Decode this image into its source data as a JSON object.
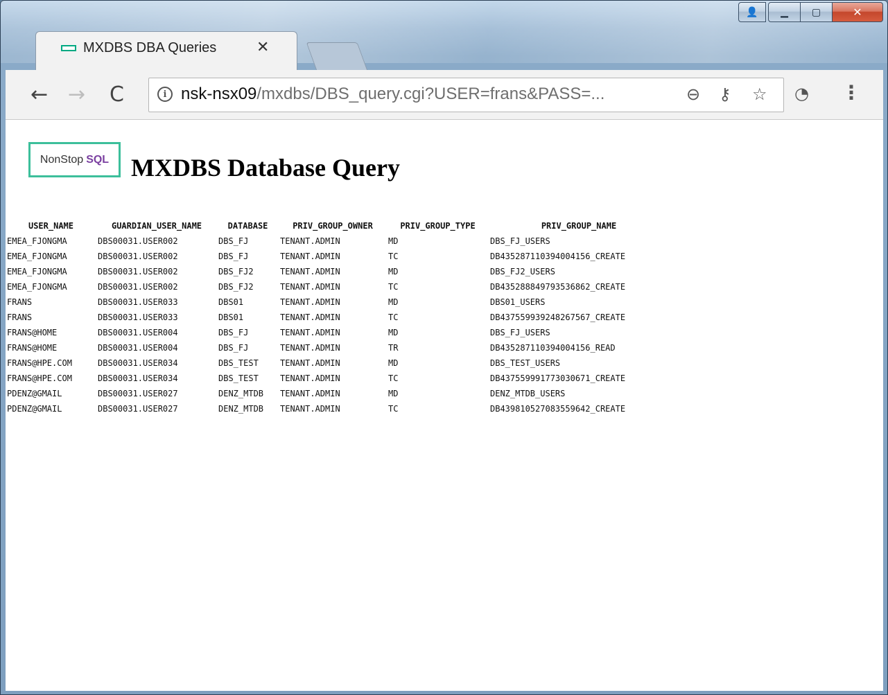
{
  "tab": {
    "title": "MXDBS DBA Queries",
    "close_glyph": "✕"
  },
  "toolbar": {
    "url_host": "nsk-nsx09",
    "url_path": "/mxdbs/DBS_query.cgi?USER=frans&PASS=..."
  },
  "page": {
    "logo_text_a": "NonStop",
    "logo_text_b": "SQL",
    "title": "MXDBS Database Query"
  },
  "table": {
    "headers": [
      "USER_NAME",
      "GUARDIAN_USER_NAME",
      "DATABASE",
      "PRIV_GROUP_OWNER",
      "PRIV_GROUP_TYPE",
      "PRIV_GROUP_NAME"
    ],
    "rows": [
      [
        "EMEA_FJONGMA",
        "DBS00031.USER002",
        "DBS_FJ",
        "TENANT.ADMIN",
        "MD",
        "DBS_FJ_USERS"
      ],
      [
        "EMEA_FJONGMA",
        "DBS00031.USER002",
        "DBS_FJ",
        "TENANT.ADMIN",
        "TC",
        "DB435287110394004156_CREATE"
      ],
      [
        "EMEA_FJONGMA",
        "DBS00031.USER002",
        "DBS_FJ2",
        "TENANT.ADMIN",
        "MD",
        "DBS_FJ2_USERS"
      ],
      [
        "EMEA_FJONGMA",
        "DBS00031.USER002",
        "DBS_FJ2",
        "TENANT.ADMIN",
        "TC",
        "DB435288849793536862_CREATE"
      ],
      [
        "FRANS",
        "DBS00031.USER033",
        "DBS01",
        "TENANT.ADMIN",
        "MD",
        "DBS01_USERS"
      ],
      [
        "FRANS",
        "DBS00031.USER033",
        "DBS01",
        "TENANT.ADMIN",
        "TC",
        "DB437559939248267567_CREATE"
      ],
      [
        "FRANS@HOME",
        "DBS00031.USER004",
        "DBS_FJ",
        "TENANT.ADMIN",
        "MD",
        "DBS_FJ_USERS"
      ],
      [
        "FRANS@HOME",
        "DBS00031.USER004",
        "DBS_FJ",
        "TENANT.ADMIN",
        "TR",
        "DB435287110394004156_READ"
      ],
      [
        "FRANS@HPE.COM",
        "DBS00031.USER034",
        "DBS_TEST",
        "TENANT.ADMIN",
        "MD",
        "DBS_TEST_USERS"
      ],
      [
        "FRANS@HPE.COM",
        "DBS00031.USER034",
        "DBS_TEST",
        "TENANT.ADMIN",
        "TC",
        "DB437559991773030671_CREATE"
      ],
      [
        "PDENZ@GMAIL",
        "DBS00031.USER027",
        "DENZ_MTDB",
        "TENANT.ADMIN",
        "MD",
        "DENZ_MTDB_USERS"
      ],
      [
        "PDENZ@GMAIL",
        "DBS00031.USER027",
        "DENZ_MTDB",
        "TENANT.ADMIN",
        "TC",
        "DB439810527083559642_CREATE"
      ]
    ]
  }
}
